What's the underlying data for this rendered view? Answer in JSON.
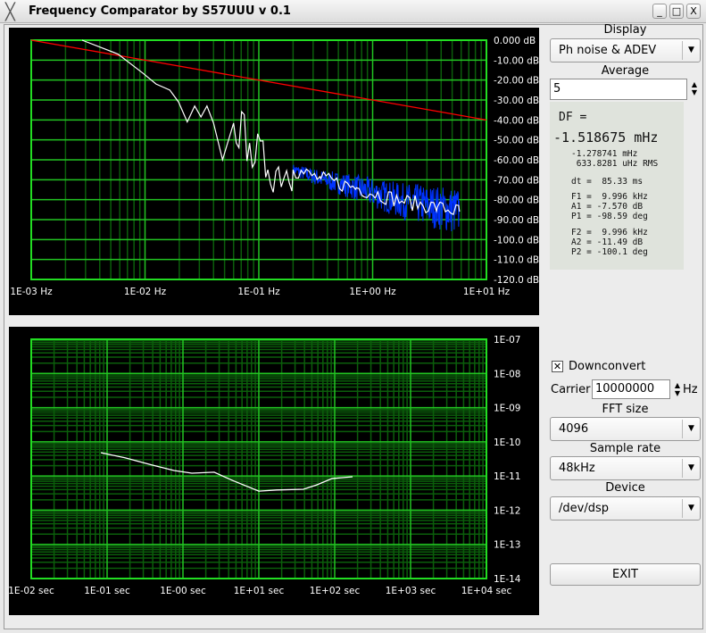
{
  "window": {
    "title": "Frequency Comparator by S57UUU  v 0.1",
    "minimize": "_",
    "maximize": "□",
    "close": "X"
  },
  "controls": {
    "display_label": "Display",
    "display_value": "Ph noise & ADEV",
    "average_label": "Average",
    "average_value": "5",
    "downconvert_label": "Downconvert",
    "downconvert_checked": true,
    "checkbox_mark": "✕",
    "carrier_label": "Carrier",
    "carrier_value": "10000000",
    "carrier_unit": "Hz",
    "fft_label": "FFT size",
    "fft_value": "4096",
    "rate_label": "Sample rate",
    "rate_value": "48kHz",
    "device_label": "Device",
    "device_value": "/dev/dsp",
    "exit_label": "EXIT"
  },
  "info": {
    "df_label": "DF =",
    "df_value": "-1.518675 mHz",
    "df_mean": "-1.278741 mHz",
    "df_rms": " 633.8281 uHz RMS",
    "dt": "dt =  85.33 ms",
    "f1": "F1 =  9.996 kHz",
    "a1": "A1 = -7.570 dB",
    "p1": "P1 = -98.59 deg",
    "f2": "F2 =  9.996 kHz",
    "a2": "A2 = -11.49 dB",
    "p2": "P2 = -100.1 deg"
  },
  "chart_data": [
    {
      "type": "line",
      "xscale": "log",
      "xlim": [
        0.001,
        10
      ],
      "ylim": [
        -120,
        0
      ],
      "grid": true,
      "xticks": [
        "1E-03 Hz",
        "1E-02 Hz",
        "1E-01 Hz",
        "1E+00 Hz",
        "1E+01 Hz"
      ],
      "yticks": [
        "0.000  dB",
        "-10.00 dBc",
        "-20.00 dBc",
        "-30.00 dBc",
        "-40.00 dBc",
        "-50.00 dBc",
        "-60.00 dBc",
        "-70.00 dBc",
        "-80.00 dBc",
        "-90.00 dBc",
        "-100.0 dBc",
        "-110.0 dBc",
        "-120.0 dBc"
      ],
      "series": [
        {
          "color": "#ff0000",
          "x": [
            0.001,
            10
          ],
          "y": [
            0,
            -40
          ]
        },
        {
          "color": "#0033ff",
          "x": [
            0.2,
            0.35,
            0.72,
            1.8,
            3.7,
            5.8
          ],
          "y": [
            -65,
            -69.5,
            -74,
            -80.7,
            -83.8,
            -86
          ]
        },
        {
          "color": "#ffffff",
          "x": [
            0.0028,
            0.0058,
            0.0096,
            0.0125,
            0.0165,
            0.0197,
            0.0235,
            0.0273,
            0.031,
            0.035,
            0.04,
            0.048,
            0.06,
            0.083,
            0.12,
            0.2,
            0.35,
            0.72,
            1.8,
            3.7,
            5.8
          ],
          "y": [
            0,
            -7,
            -16.6,
            -22,
            -25,
            -31,
            -41,
            -33,
            -38.5,
            -33,
            -41.6,
            -60,
            -41.6,
            -51.6,
            -65,
            -65,
            -69.5,
            -74,
            -80.7,
            -83.8,
            -86
          ]
        }
      ]
    },
    {
      "type": "line",
      "xscale": "log",
      "yscale": "log",
      "xlim": [
        0.01,
        10000
      ],
      "ylim": [
        1e-14,
        1e-07
      ],
      "grid": true,
      "xticks": [
        "1E-02 sec",
        "1E-01 sec",
        "1E-00 sec",
        "1E+01 sec",
        "1E+02 sec",
        "1E+03 sec",
        "1E+04 sec"
      ],
      "yticks": [
        "1E-07",
        "1E-08",
        "1E-09",
        "1E-10",
        "1E-11",
        "1E-12",
        "1E-13",
        "1E-14"
      ],
      "series": [
        {
          "color": "#ffffff",
          "x": [
            0.083,
            0.172,
            0.387,
            0.762,
            1.31,
            2.58,
            4.44,
            10,
            17.2,
            38.7,
            58,
            92,
            172
          ],
          "y": [
            4.8e-11,
            3.4e-11,
            2.1e-11,
            1.45e-11,
            1.21e-11,
            1.29e-11,
            7.5e-12,
            3.6e-12,
            3.9e-12,
            4.1e-12,
            5.5e-12,
            8.4e-12,
            9.5e-12
          ]
        }
      ]
    }
  ]
}
